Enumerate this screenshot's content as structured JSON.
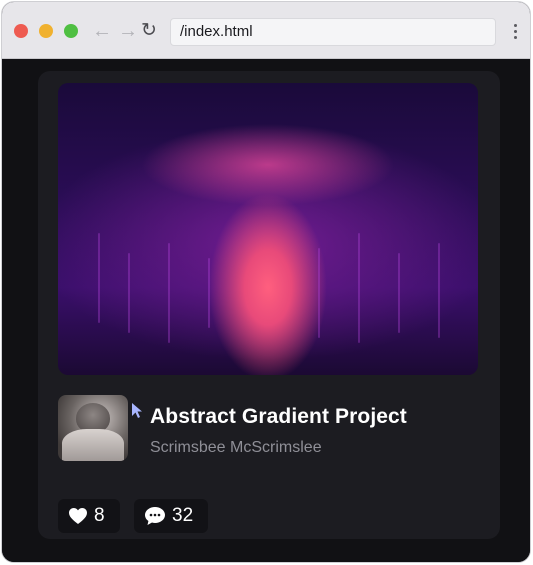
{
  "browser": {
    "url": "/index.html",
    "nav_back_icon": "arrow-left-icon",
    "nav_forward_icon": "arrow-right-icon",
    "reload_icon": "reload-icon",
    "menu_icon": "kebab-menu-icon"
  },
  "card": {
    "title": "Abstract Gradient Project",
    "author": "Scrimsbee McScrimslee",
    "likes": "8",
    "comments": "32",
    "like_icon": "heart-icon",
    "comment_icon": "chat-bubble-icon"
  },
  "colors": {
    "card_bg": "#1c1c21",
    "page_bg": "#111114",
    "title": "#ffffff",
    "author": "#8f8f97",
    "accent": "#ff5f7e"
  }
}
